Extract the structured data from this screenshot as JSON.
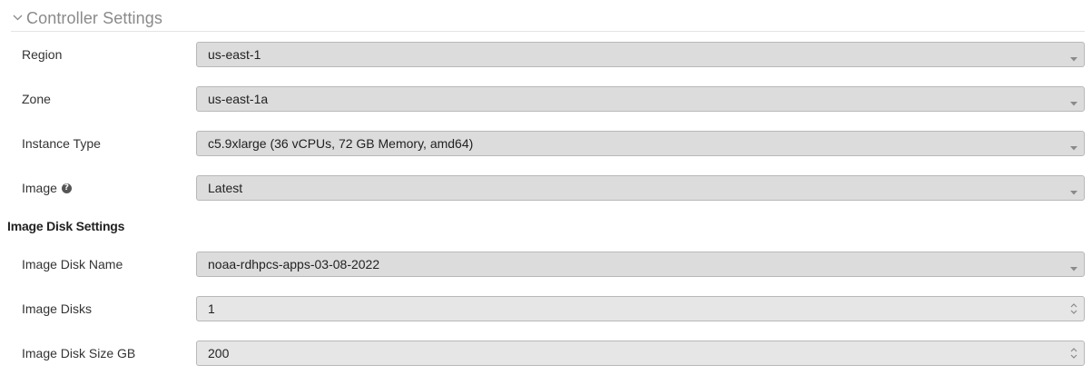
{
  "section": {
    "title": "Controller Settings"
  },
  "fields": [
    {
      "label": "Region",
      "value": "us-east-1",
      "kind": "select"
    },
    {
      "label": "Zone",
      "value": "us-east-1a",
      "kind": "select"
    },
    {
      "label": "Instance Type",
      "value": "c5.9xlarge (36 vCPUs, 72 GB Memory, amd64)",
      "kind": "select"
    },
    {
      "label": "Image",
      "value": "Latest",
      "kind": "select",
      "help_icon": "question-circle-icon"
    }
  ],
  "disk": {
    "heading": "Image Disk Settings",
    "fields": [
      {
        "label": "Image Disk Name",
        "value": "noaa-rdhpcs-apps-03-08-2022",
        "kind": "select"
      },
      {
        "label": "Image Disks",
        "value": "1",
        "kind": "number"
      },
      {
        "label": "Image Disk Size GB",
        "value": "200",
        "kind": "number"
      }
    ]
  },
  "icons": {
    "collapse": "chevron-down-icon",
    "select": "dropdown-caret-icon",
    "number": "spinner-arrows-icon"
  },
  "colors": {
    "section_title": "#8a8a8a",
    "select_bg": "#dcdcdc",
    "number_bg": "#e6e6e6",
    "border": "#b8b8b8"
  }
}
